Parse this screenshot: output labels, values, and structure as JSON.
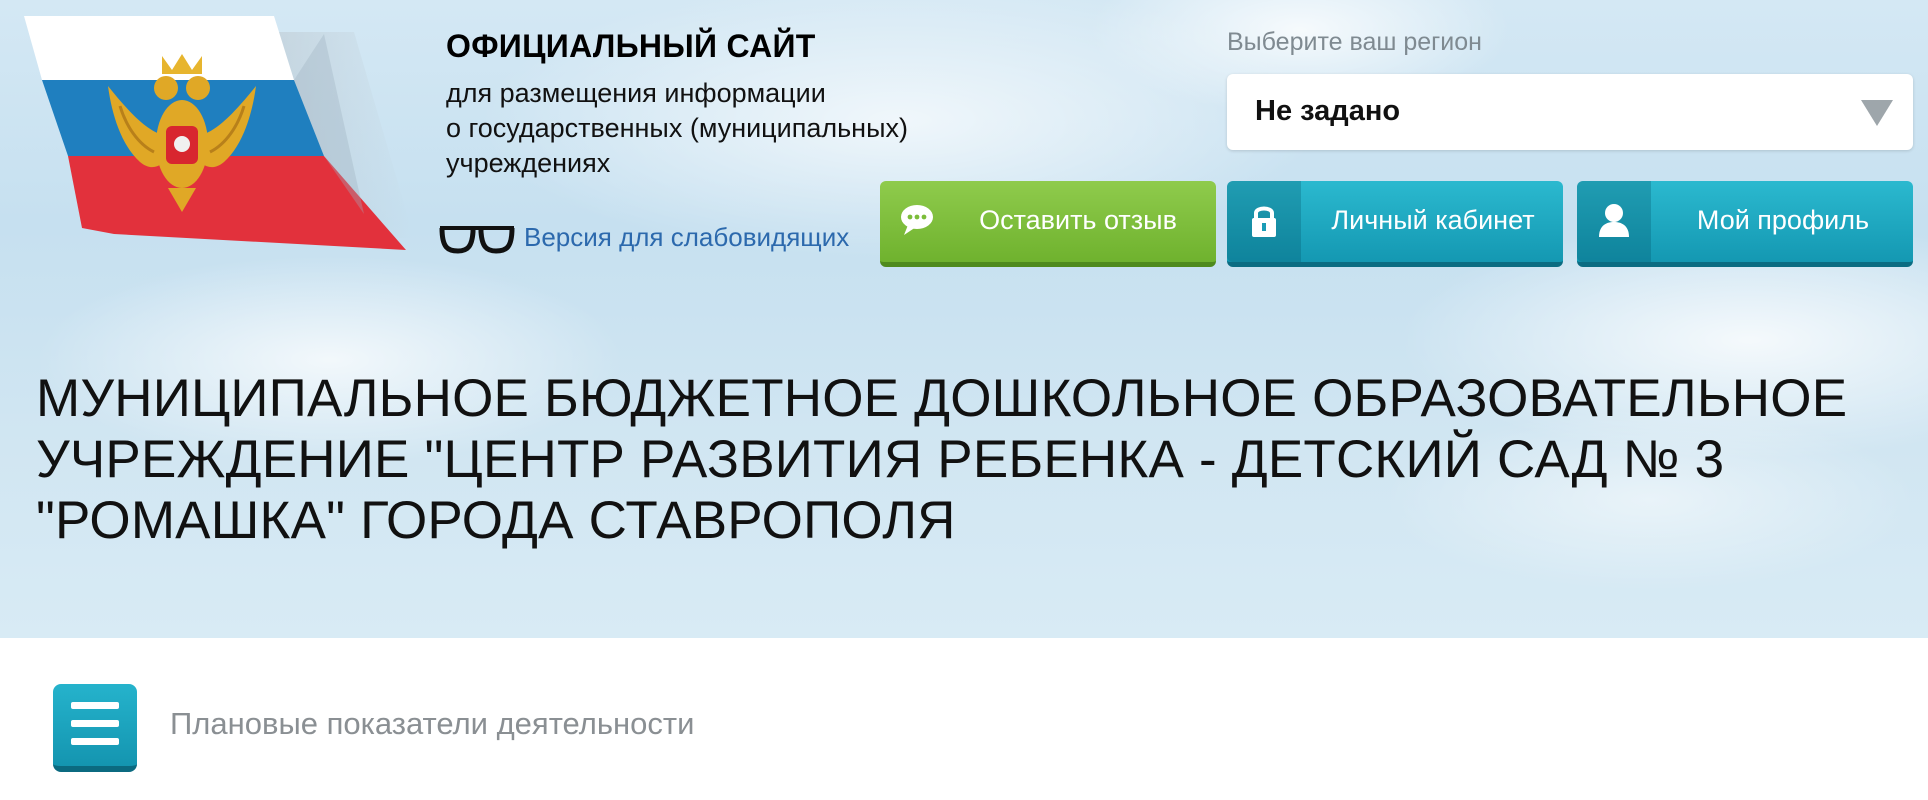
{
  "header": {
    "site_title": "ОФИЦИАЛЬНЫЙ САЙТ",
    "site_subtitle_lines": [
      "для размещения информации",
      "о государственных (муниципальных)",
      "учреждениях"
    ],
    "low_vision_link": "Версия для слабовидящих"
  },
  "region": {
    "label": "Выберите ваш регион",
    "selected": "Не задано"
  },
  "buttons": {
    "feedback": "Оставить отзыв",
    "cabinet": "Личный кабинет",
    "profile": "Мой профиль"
  },
  "organization": {
    "title": "МУНИЦИПАЛЬНОЕ БЮДЖЕТНОЕ ДОШКОЛЬНОЕ ОБРАЗОВАТЕЛЬНОЕ УЧРЕЖДЕНИЕ \"ЦЕНТР РАЗВИТИЯ РЕБЕНКА - ДЕТСКИЙ САД № 3 \"РОМАШКА\" ГОРОДА СТАВРОПОЛЯ"
  },
  "section": {
    "breadcrumb": "Плановые показатели деятельности"
  },
  "colors": {
    "flag_white": "#ffffff",
    "flag_blue": "#1f7fbf",
    "flag_red": "#e2313c",
    "green_button": "#7cbd3a",
    "teal_button": "#1aa6c0",
    "link_blue": "#2c69ad"
  },
  "icons": {
    "logo": "russian-coat-of-arms-flag-icon",
    "low_vision": "glasses-icon",
    "feedback": "speech-bubble-icon",
    "cabinet": "lock-icon",
    "profile": "user-icon",
    "menu": "hamburger-menu-icon",
    "region_dropdown": "triangle-down-icon"
  }
}
